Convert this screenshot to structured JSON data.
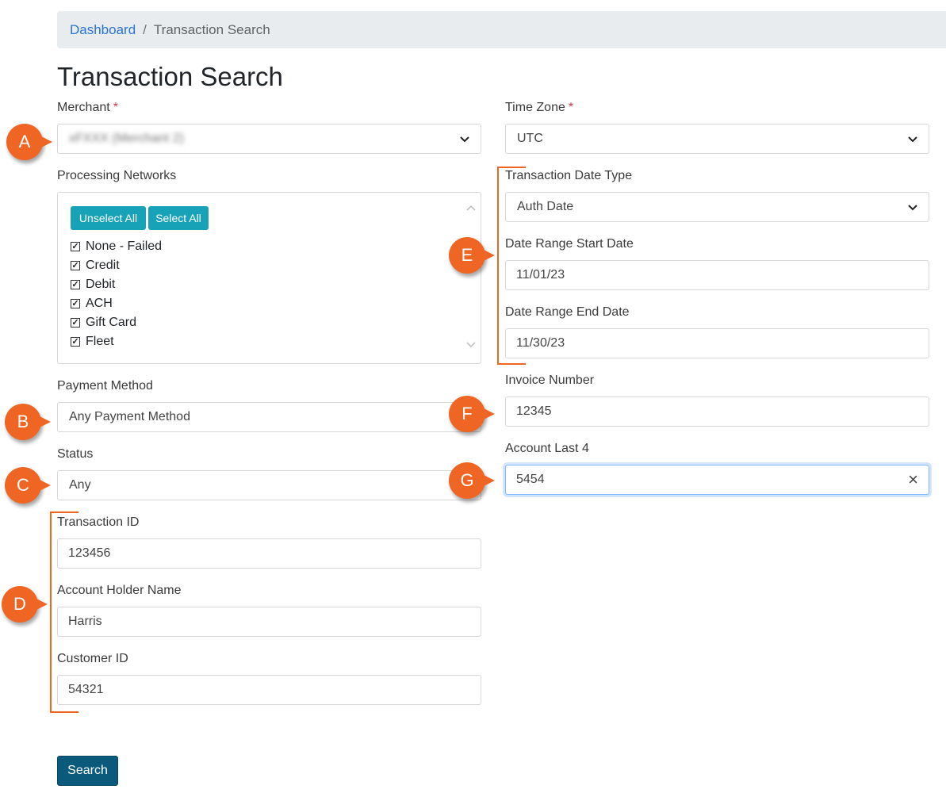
{
  "breadcrumb": {
    "link": "Dashboard",
    "separator": "/",
    "current": "Transaction Search"
  },
  "page_title": "Transaction Search",
  "required_mark": "*",
  "merchant": {
    "label": "Merchant",
    "value": "xFXXX (Merchant 2)"
  },
  "time_zone": {
    "label": "Time Zone",
    "value": "UTC"
  },
  "processing_networks": {
    "label": "Processing Networks",
    "unselect_all": "Unselect All",
    "select_all": "Select All",
    "items": [
      {
        "label": "None - Failed",
        "checked": true
      },
      {
        "label": "Credit",
        "checked": true
      },
      {
        "label": "Debit",
        "checked": true
      },
      {
        "label": "ACH",
        "checked": true
      },
      {
        "label": "Gift Card",
        "checked": true
      },
      {
        "label": "Fleet",
        "checked": true
      }
    ],
    "check_glyph": "✓"
  },
  "transaction_date_type": {
    "label": "Transaction Date Type",
    "value": "Auth Date"
  },
  "date_start": {
    "label": "Date Range Start Date",
    "value": "11/01/23"
  },
  "date_end": {
    "label": "Date Range End Date",
    "value": "11/30/23"
  },
  "payment_method": {
    "label": "Payment Method",
    "value": "Any Payment Method"
  },
  "invoice_number": {
    "label": "Invoice Number",
    "value": "12345"
  },
  "status": {
    "label": "Status",
    "value": "Any"
  },
  "account_last4": {
    "label": "Account Last 4",
    "value": "5454",
    "clear_icon": "×"
  },
  "transaction_id": {
    "label": "Transaction ID",
    "value": "123456"
  },
  "account_holder_name": {
    "label": "Account Holder Name",
    "value": "Harris"
  },
  "customer_id": {
    "label": "Customer ID",
    "value": "54321"
  },
  "search_button": "Search",
  "callouts": {
    "a": "A",
    "b": "B",
    "c": "C",
    "d": "D",
    "e": "E",
    "f": "F",
    "g": "G"
  },
  "colors": {
    "callout": "#ef6523",
    "teal_button": "#17a2b8",
    "search_button": "#0b5a7c",
    "link": "#2a72d6"
  }
}
